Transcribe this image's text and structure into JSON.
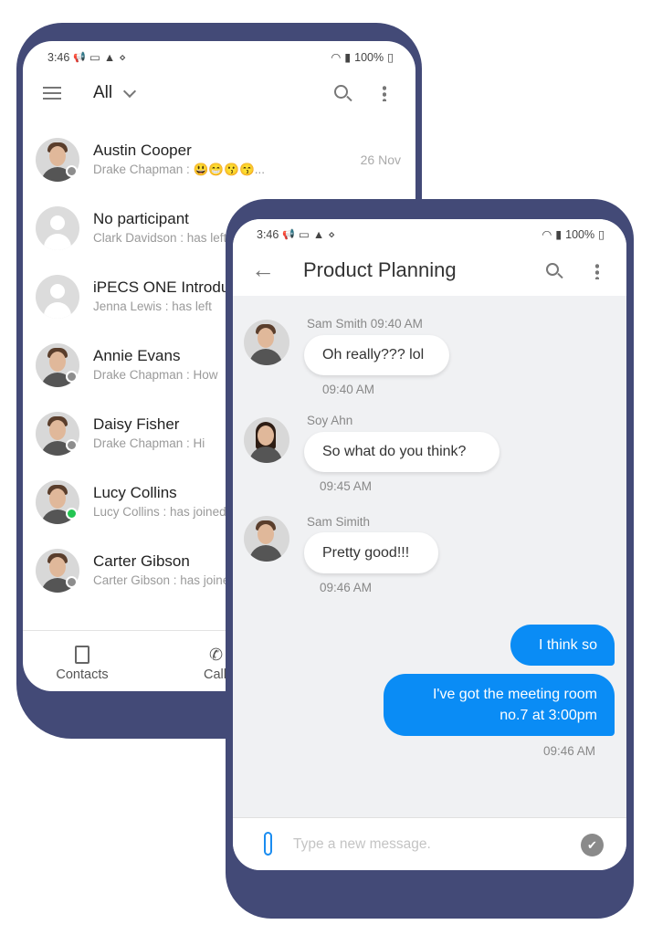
{
  "left_phone": {
    "status": {
      "time": "3:46",
      "battery": "100%"
    },
    "header": {
      "filter": "All"
    },
    "chats": [
      {
        "name": "Austin Cooper",
        "preview": "Drake Chapman : 😃😁😗😙...",
        "date": "26 Nov",
        "presence": "offline",
        "avatar": "photo"
      },
      {
        "name": "No participant",
        "preview": "Clark Davidson : has left",
        "presence": "none",
        "avatar": "placeholder"
      },
      {
        "name": "iPECS ONE Introduction",
        "preview": "Jenna Lewis : has left",
        "presence": "none",
        "avatar": "placeholder"
      },
      {
        "name": "Annie Evans",
        "preview": "Drake Chapman : How",
        "presence": "offline",
        "avatar": "photo"
      },
      {
        "name": "Daisy Fisher",
        "preview": "Drake Chapman : Hi",
        "presence": "offline",
        "avatar": "photo"
      },
      {
        "name": "Lucy Collins",
        "preview": "Lucy Collins : has joined",
        "presence": "online",
        "avatar": "photo"
      },
      {
        "name": "Carter Gibson",
        "preview": "Carter Gibson : has joined",
        "presence": "offline",
        "avatar": "photo"
      }
    ],
    "bottom_nav": [
      {
        "label": "Contacts",
        "icon": "contacts-icon"
      },
      {
        "label": "Calls",
        "icon": "phone-icon"
      }
    ]
  },
  "right_phone": {
    "status": {
      "time": "3:46",
      "battery": "100%"
    },
    "header": {
      "title": "Product Planning"
    },
    "messages": [
      {
        "direction": "in",
        "sender": "Sam Smith",
        "sent": "09:40 AM",
        "text": "Oh really??? lol",
        "time": "09:40 AM"
      },
      {
        "direction": "in",
        "sender": "Soy Ahn",
        "text": "So what do you think?",
        "time": "09:45 AM"
      },
      {
        "direction": "in",
        "sender": "Sam Simith",
        "text": "Pretty good!!!",
        "time": "09:46 AM"
      },
      {
        "direction": "out",
        "text": "I think so"
      },
      {
        "direction": "out",
        "text_line1": "I've got the meeting room",
        "text_line2": "no.7 at 3:00pm",
        "time": "09:46 AM"
      }
    ],
    "composer": {
      "placeholder": "Type a new message."
    }
  },
  "colors": {
    "frame": "#434a77",
    "accent": "#0a8cf5",
    "chat_bg": "#f0f1f3",
    "online": "#23c552",
    "offline": "#8d8d8d"
  }
}
